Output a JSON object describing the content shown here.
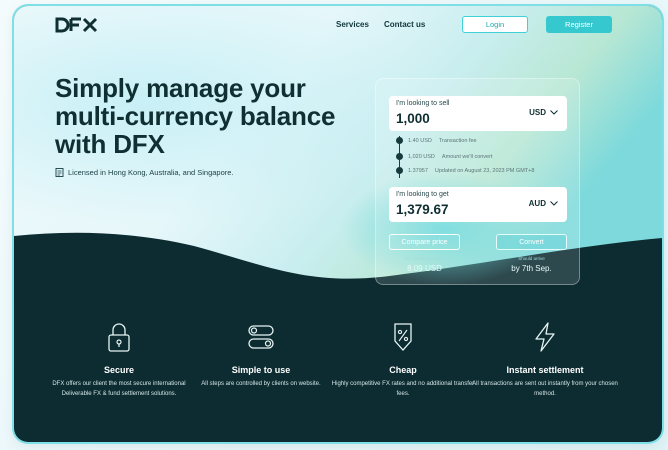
{
  "brand": {
    "name": "DFX",
    "text_color": "#0f2f33",
    "accent": "#35c8cf"
  },
  "nav": {
    "links": [
      "Services",
      "Contact us"
    ],
    "login_label": "Login",
    "register_label": "Register"
  },
  "hero": {
    "title": "Simply manage your multi-currency balance with DFX",
    "licensed_text": "Licensed in Hong Kong, Australia, and Singapore."
  },
  "converter": {
    "sell_label": "I'm looking to sell",
    "sell_amount": "1,000",
    "sell_currency": "USD",
    "get_label": "I'm looking to get",
    "get_amount": "1,379.67",
    "get_currency": "AUD",
    "steps": [
      {
        "value": "1.40 USD",
        "note": "Transaction fee"
      },
      {
        "value": "1,020 USD",
        "note": "Amount we'll convert"
      },
      {
        "value": "1.37957",
        "note": "Updated on August 23, 2023 PM GMT+8"
      }
    ],
    "compare_label": "Compare price",
    "convert_label": "Convert",
    "save_note": "You could save up to",
    "save_value": "8.09 USD",
    "arrive_note": "Should arrive",
    "arrive_value": "by 7th Sep."
  },
  "features": [
    {
      "icon": "lock-icon",
      "title": "Secure",
      "description": "DFX offers our client the most secure international Deliverable FX & fund settlement solutions."
    },
    {
      "icon": "toggle-switch-icon",
      "title": "Simple to use",
      "description": "All steps are controlled by clients on website."
    },
    {
      "icon": "percent-tag-icon",
      "title": "Cheap",
      "description": "Highly competitive FX rates and no additional transfer fees."
    },
    {
      "icon": "lightning-icon",
      "title": "Instant settlement",
      "description": "All transactions are sent out instantly from your chosen method."
    }
  ]
}
